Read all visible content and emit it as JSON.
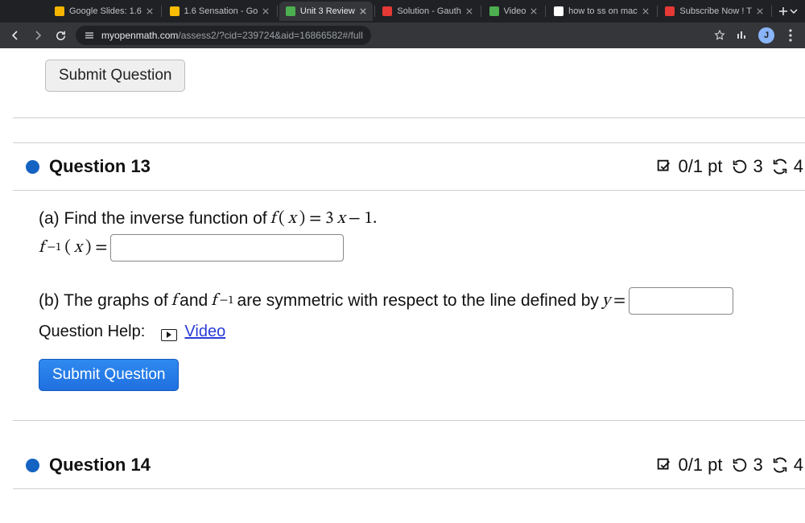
{
  "browser": {
    "tabs": [
      {
        "title": "Google Slides: 1.6"
      },
      {
        "title": "1.6 Sensation - Go"
      },
      {
        "title": "Unit 3 Review"
      },
      {
        "title": "Solution - Gauth"
      },
      {
        "title": "Video"
      },
      {
        "title": "how to ss on mac"
      },
      {
        "title": "Subscribe Now ! T"
      }
    ],
    "url_host": "myopenmath.com",
    "url_path": "/assess2/?cid=239724&aid=16866582#/full",
    "avatar_initial": "J"
  },
  "topbar": {
    "submit_label": "Submit Question"
  },
  "q13": {
    "title": "Question 13",
    "score": "0/1 pt",
    "attempts_remaining": "3",
    "reattempts": "4",
    "part_a_lead": "(a) Find the inverse function of ",
    "part_a_func_lhs": "f(x) = 3x − 1.",
    "answer_a_label_lhs": "f",
    "answer_a_label_sup": "−1",
    "answer_a_label_rhs": "(x) = ",
    "part_b_1": "(b) The graphs of ",
    "part_b_f": "f",
    "part_b_and": " and ",
    "part_b_finv_base": "f",
    "part_b_finv_sup": "−1",
    "part_b_2": " are symmetric with respect to the line defined by ",
    "part_b_y": "y = ",
    "help_label": "Question Help:",
    "video_label": "Video",
    "submit_label": "Submit Question"
  },
  "q14": {
    "title": "Question 14",
    "score": "0/1 pt",
    "attempts_remaining": "3",
    "reattempts": "4"
  }
}
